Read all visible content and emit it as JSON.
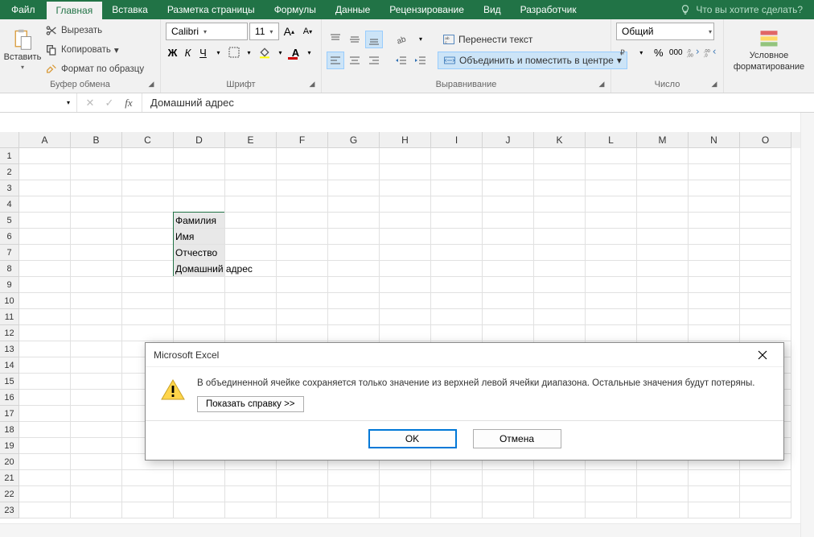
{
  "tabs": {
    "file": "Файл",
    "list": [
      "Главная",
      "Вставка",
      "Разметка страницы",
      "Формулы",
      "Данные",
      "Рецензирование",
      "Вид",
      "Разработчик"
    ],
    "active_index": 0,
    "search_placeholder": "Что вы хотите сделать?"
  },
  "ribbon": {
    "clipboard": {
      "paste": "Вставить",
      "cut": "Вырезать",
      "copy": "Копировать",
      "format_painter": "Формат по образцу",
      "title": "Буфер обмена"
    },
    "font": {
      "name": "Calibri",
      "size": "11",
      "bold": "Ж",
      "italic": "К",
      "underline": "Ч",
      "title": "Шрифт"
    },
    "alignment": {
      "wrap": "Перенести текст",
      "merge": "Объединить и поместить в центре",
      "title": "Выравнивание"
    },
    "number": {
      "format": "Общий",
      "title": "Число"
    },
    "styles": {
      "conditional": "Условное форматирование",
      "conditional_l1": "Условное",
      "conditional_l2": "форматирование"
    }
  },
  "formula_bar": {
    "namebox": "",
    "value": "Домашний адрес"
  },
  "grid": {
    "columns": [
      "A",
      "B",
      "C",
      "D",
      "E",
      "F",
      "G",
      "H",
      "I",
      "J",
      "K",
      "L",
      "M",
      "N",
      "O"
    ],
    "rows": 23,
    "data": {
      "D5": "Фамилия",
      "D6": "Имя",
      "D7": "Отчество",
      "D8": "Домашний адрес"
    },
    "selection": {
      "col": "D",
      "row_start": 5,
      "row_end": 8
    }
  },
  "dialog": {
    "app": "Microsoft Excel",
    "message": "В объединенной ячейке сохраняется только значение из верхней левой ячейки диапазона. Остальные значения будут потеряны.",
    "help": "Показать справку >>",
    "ok": "OK",
    "cancel": "Отмена"
  }
}
